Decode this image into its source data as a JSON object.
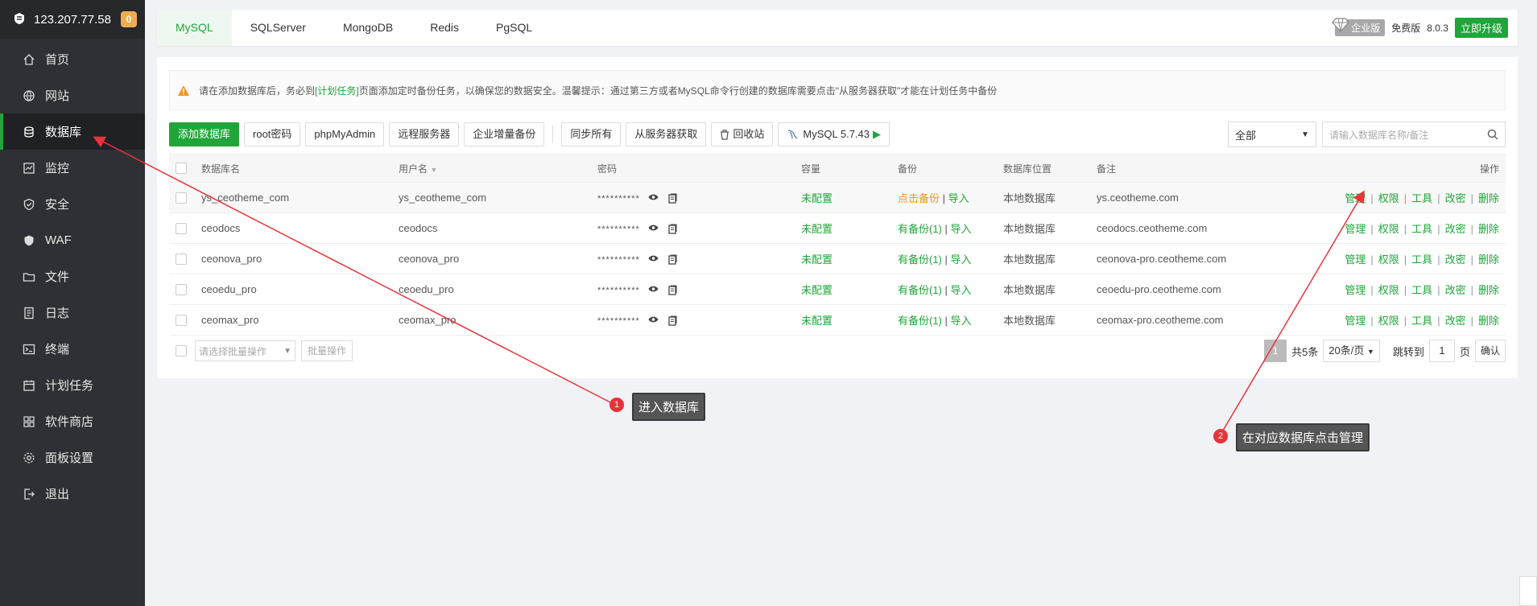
{
  "sidebar": {
    "ip": "123.207.77.58",
    "badge": "0",
    "items": [
      {
        "label": "首页",
        "icon": "home-icon"
      },
      {
        "label": "网站",
        "icon": "globe-icon"
      },
      {
        "label": "数据库",
        "icon": "database-icon",
        "active": true
      },
      {
        "label": "监控",
        "icon": "monitor-icon"
      },
      {
        "label": "安全",
        "icon": "shield-icon"
      },
      {
        "label": "WAF",
        "icon": "waf-shield-icon"
      },
      {
        "label": "文件",
        "icon": "folder-icon"
      },
      {
        "label": "日志",
        "icon": "log-icon"
      },
      {
        "label": "终端",
        "icon": "terminal-icon"
      },
      {
        "label": "计划任务",
        "icon": "calendar-icon"
      },
      {
        "label": "软件商店",
        "icon": "apps-icon"
      },
      {
        "label": "面板设置",
        "icon": "settings-icon"
      },
      {
        "label": "退出",
        "icon": "logout-icon"
      }
    ]
  },
  "tabs": [
    "MySQL",
    "SQLServer",
    "MongoDB",
    "Redis",
    "PgSQL"
  ],
  "header_right": {
    "edition": "企业版",
    "free": "免费版",
    "version": "8.0.3",
    "upgrade": "立即升级"
  },
  "notice": {
    "prefix": "请在添加数据库后，务必到",
    "link": "[计划任务]",
    "suffix": "页面添加定时备份任务，以确保您的数据安全。温馨提示：通过第三方或者MySQL命令行创建的数据库需要点击\"从服务器获取\"才能在计划任务中备份"
  },
  "toolbar": {
    "add_db": "添加数据库",
    "root_pw": "root密码",
    "phpmyadmin": "phpMyAdmin",
    "remote": "远程服务器",
    "enterprise_backup": "企业增量备份",
    "sync_all": "同步所有",
    "from_server": "从服务器获取",
    "recycle": "回收站",
    "mysql_version": "MySQL 5.7.43",
    "filter": "全部",
    "search_placeholder": "请输入数据库名称/备注"
  },
  "table": {
    "headers": {
      "name": "数据库名",
      "user": "用户名",
      "password": "密码",
      "capacity": "容量",
      "backup": "备份",
      "location": "数据库位置",
      "remark": "备注",
      "ops": "操作"
    },
    "rows": [
      {
        "name": "ys_ceotheme_com",
        "user": "ys_ceotheme_com",
        "password": "**********",
        "capacity": "未配置",
        "backup": "点击备份",
        "backup_state": "none",
        "import": "导入",
        "location": "本地数据库",
        "remark": "ys.ceotheme.com"
      },
      {
        "name": "ceodocs",
        "user": "ceodocs",
        "password": "**********",
        "capacity": "未配置",
        "backup": "有备份(1)",
        "backup_state": "has",
        "import": "导入",
        "location": "本地数据库",
        "remark": "ceodocs.ceotheme.com"
      },
      {
        "name": "ceonova_pro",
        "user": "ceonova_pro",
        "password": "**********",
        "capacity": "未配置",
        "backup": "有备份(1)",
        "backup_state": "has",
        "import": "导入",
        "location": "本地数据库",
        "remark": "ceonova-pro.ceotheme.com"
      },
      {
        "name": "ceoedu_pro",
        "user": "ceoedu_pro",
        "password": "**********",
        "capacity": "未配置",
        "backup": "有备份(1)",
        "backup_state": "has",
        "import": "导入",
        "location": "本地数据库",
        "remark": "ceoedu-pro.ceotheme.com"
      },
      {
        "name": "ceomax_pro",
        "user": "ceomax_pro",
        "password": "**********",
        "capacity": "未配置",
        "backup": "有备份(1)",
        "backup_state": "has",
        "import": "导入",
        "location": "本地数据库",
        "remark": "ceomax-pro.ceotheme.com"
      }
    ],
    "ops": [
      "管理",
      "权限",
      "工具",
      "改密",
      "删除"
    ]
  },
  "footer": {
    "batch_placeholder": "请选择批量操作",
    "batch_btn": "批量操作",
    "current_page": "1",
    "total": "共5条",
    "page_size": "20条/页",
    "jump_to": "跳转到",
    "jump_value": "1",
    "page_unit": "页",
    "confirm": "确认"
  },
  "annotations": [
    {
      "num": "1",
      "text": "进入数据库"
    },
    {
      "num": "2",
      "text": "在对应数据库点击管理"
    }
  ],
  "colors": {
    "accent": "#20a53a",
    "sidebar": "#2e3035",
    "annotation": "#e8333a"
  }
}
